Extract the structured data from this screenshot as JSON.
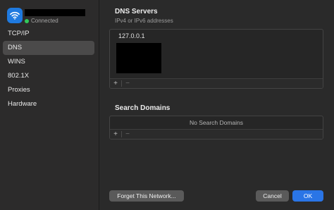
{
  "network": {
    "status": "Connected",
    "status_color": "#32c95a",
    "icon": "wifi-icon"
  },
  "sidebar": {
    "items": [
      {
        "label": "TCP/IP"
      },
      {
        "label": "DNS",
        "active": true
      },
      {
        "label": "WINS"
      },
      {
        "label": "802.1X"
      },
      {
        "label": "Proxies"
      },
      {
        "label": "Hardware"
      }
    ]
  },
  "dns": {
    "title": "DNS Servers",
    "subtitle": "IPv4 or IPv6 addresses",
    "entries": [
      "127.0.0.1"
    ],
    "add_label": "+",
    "remove_label": "−"
  },
  "search_domains": {
    "title": "Search Domains",
    "empty_text": "No Search Domains",
    "add_label": "+",
    "remove_label": "−"
  },
  "buttons": {
    "forget": "Forget This Network...",
    "cancel": "Cancel",
    "ok": "OK"
  },
  "colors": {
    "accent": "#2a75e6",
    "wifi_badge": "#1f7ae0"
  }
}
